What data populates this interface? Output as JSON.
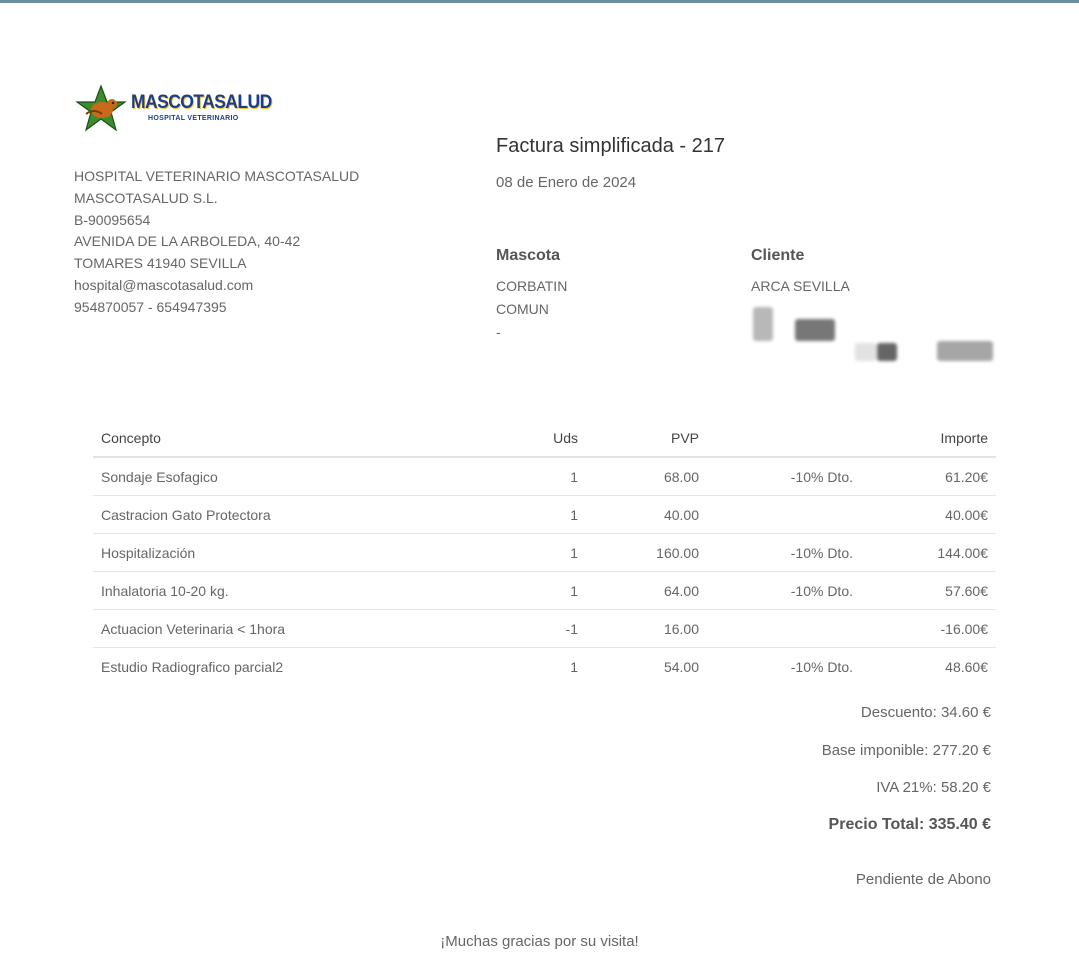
{
  "logo": {
    "name": "MASCOTASALUD",
    "subtitle": "HOSPITAL VETERINARIO"
  },
  "company": {
    "lines": [
      "HOSPITAL VETERINARIO MASCOTASALUD",
      "MASCOTASALUD S.L.",
      "B-90095654",
      "AVENIDA DE LA ARBOLEDA, 40-42",
      "TOMARES 41940 SEVILLA",
      "hospital@mascotasalud.com",
      "954870057 - 654947395"
    ]
  },
  "invoice": {
    "title": "Factura simplificada - 217",
    "date": "08 de Enero de 2024"
  },
  "pet": {
    "heading": "Mascota",
    "lines": [
      "CORBATIN",
      "COMUN",
      "-"
    ]
  },
  "client": {
    "heading": "Cliente",
    "name": "ARCA SEVILLA"
  },
  "table": {
    "headers": {
      "concept": "Concepto",
      "units": "Uds",
      "price": "PVP",
      "discount": "",
      "amount": "Importe"
    },
    "rows": [
      {
        "concept": "Sondaje Esofagico",
        "units": "1",
        "price": "68.00",
        "discount": "-10% Dto.",
        "amount": "61.20€"
      },
      {
        "concept": "Castracion Gato Protectora",
        "units": "1",
        "price": "40.00",
        "discount": "",
        "amount": "40.00€"
      },
      {
        "concept": "Hospitalización",
        "units": "1",
        "price": "160.00",
        "discount": "-10% Dto.",
        "amount": "144.00€"
      },
      {
        "concept": "Inhalatoria 10-20 kg.",
        "units": "1",
        "price": "64.00",
        "discount": "-10% Dto.",
        "amount": "57.60€"
      },
      {
        "concept": "Actuacion Veterinaria < 1hora",
        "units": "-1",
        "price": "16.00",
        "discount": "",
        "amount": "-16.00€"
      },
      {
        "concept": "Estudio Radiografico parcial2",
        "units": "1",
        "price": "54.00",
        "discount": "-10% Dto.",
        "amount": "48.60€"
      }
    ]
  },
  "totals": {
    "discount": "Descuento: 34.60 €",
    "base": "Base imponible: 277.20 €",
    "vat": "IVA 21%: 58.20 €",
    "total": "Precio Total: 335.40 €",
    "status": "Pendiente de Abono"
  },
  "footer": {
    "thanks": "¡Muchas gracias por su visita!"
  }
}
